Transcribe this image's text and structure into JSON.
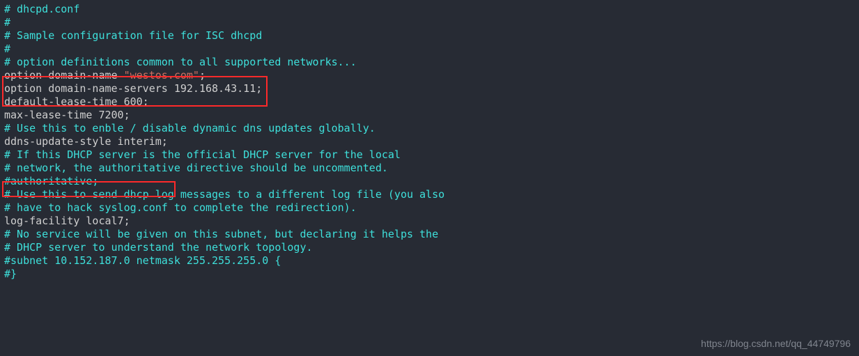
{
  "lines": [
    {
      "cls": "comment",
      "text": "# dhcpd.conf"
    },
    {
      "cls": "comment",
      "text": "#"
    },
    {
      "cls": "comment",
      "text": "# Sample configuration file for ISC dhcpd"
    },
    {
      "cls": "comment",
      "text": "#"
    },
    {
      "cls": "plain",
      "text": ""
    },
    {
      "cls": "comment",
      "text": "# option definitions common to all supported networks..."
    },
    {
      "segments": [
        {
          "cls": "plain",
          "text": "option domain-name "
        },
        {
          "cls": "string",
          "text": "\"westos.com\""
        },
        {
          "cls": "plain",
          "text": ";"
        }
      ]
    },
    {
      "cls": "plain",
      "text": "option domain-name-servers 192.168.43.11;"
    },
    {
      "cls": "plain",
      "text": ""
    },
    {
      "cls": "plain",
      "text": "default-lease-time 600;"
    },
    {
      "cls": "plain",
      "text": "max-lease-time 7200;"
    },
    {
      "cls": "plain",
      "text": ""
    },
    {
      "cls": "comment",
      "text": "# Use this to enble / disable dynamic dns updates globally."
    },
    {
      "cls": "plain",
      "text": "ddns-update-style interim;"
    },
    {
      "cls": "plain",
      "text": ""
    },
    {
      "cls": "comment",
      "text": "# If this DHCP server is the official DHCP server for the local"
    },
    {
      "cls": "comment",
      "text": "# network, the authoritative directive should be uncommented."
    },
    {
      "cls": "comment",
      "text": "#authoritative;"
    },
    {
      "cls": "plain",
      "text": ""
    },
    {
      "cls": "comment",
      "text": "# Use this to send dhcp log messages to a different log file (you also"
    },
    {
      "cls": "comment",
      "text": "# have to hack syslog.conf to complete the redirection)."
    },
    {
      "cls": "plain",
      "text": "log-facility local7;"
    },
    {
      "cls": "plain",
      "text": ""
    },
    {
      "cls": "comment",
      "text": "# No service will be given on this subnet, but declaring it helps the"
    },
    {
      "cls": "comment",
      "text": "# DHCP server to understand the network topology."
    },
    {
      "cls": "plain",
      "text": ""
    },
    {
      "cls": "comment",
      "text": "#subnet 10.152.187.0 netmask 255.255.255.0 {"
    },
    {
      "cls": "comment",
      "text": "#}"
    }
  ],
  "highlights": {
    "box1_desc": "option domain-name / domain-name-servers lines",
    "box2_desc": "ddns-update-style interim; line"
  },
  "watermark": "https://blog.csdn.net/qq_44749796"
}
